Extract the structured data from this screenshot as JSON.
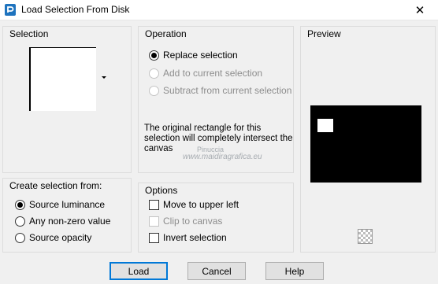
{
  "window": {
    "title": "Load Selection From Disk",
    "close_glyph": "✕"
  },
  "selection": {
    "title": "Selection"
  },
  "operation": {
    "title": "Operation",
    "options": [
      {
        "label": "Replace selection",
        "checked": true,
        "enabled": true
      },
      {
        "label": "Add to current selection",
        "checked": false,
        "enabled": false
      },
      {
        "label": "Subtract from current selection",
        "checked": false,
        "enabled": false
      }
    ],
    "info": "The original rectangle for this selection will completely intersect the canvas"
  },
  "preview": {
    "title": "Preview"
  },
  "create_from": {
    "title": "Create selection from:",
    "options": [
      {
        "label": "Source luminance",
        "checked": true
      },
      {
        "label": "Any non-zero value",
        "checked": false
      },
      {
        "label": "Source opacity",
        "checked": false
      }
    ]
  },
  "options": {
    "title": "Options",
    "items": [
      {
        "label": "Move to upper left",
        "checked": false,
        "enabled": true
      },
      {
        "label": "Clip to canvas",
        "checked": false,
        "enabled": false
      },
      {
        "label": "Invert selection",
        "checked": false,
        "enabled": true
      }
    ]
  },
  "watermark": {
    "line1": "Pinuccia",
    "line2": "www.maidiragrafica.eu"
  },
  "buttons": {
    "load": "Load",
    "cancel": "Cancel",
    "help": "Help"
  }
}
